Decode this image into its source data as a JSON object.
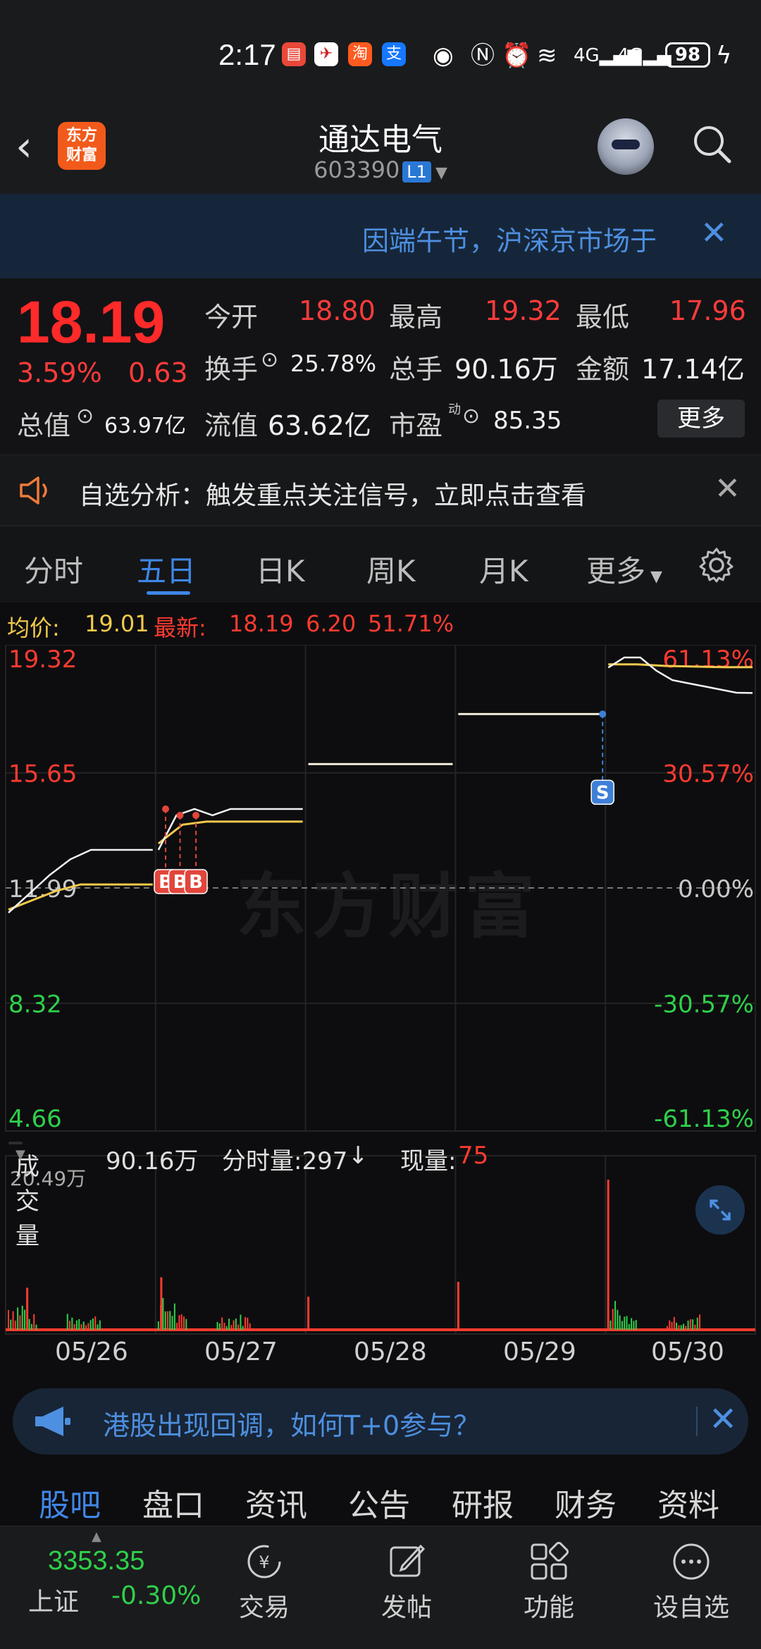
{
  "status": {
    "time": "2:17",
    "apps": [
      "huawei-app-icon",
      "airport-app-icon",
      "taobao-app-icon",
      "alipay-app-icon"
    ],
    "battery": "98"
  },
  "header": {
    "logo": "东方\n财富",
    "stock_name": "通达电气",
    "stock_code": "603390",
    "level": "L1"
  },
  "notice": {
    "text": "因端午节，沪深京市场于"
  },
  "quote": {
    "price": "18.19",
    "change_pct": "3.59%",
    "change": "0.63",
    "open_label": "今开",
    "open": "18.80",
    "high_label": "最高",
    "high": "19.32",
    "low_label": "最低",
    "low": "17.96",
    "turnover_label": "换手",
    "turnover": "25.78%",
    "volume_label": "总手",
    "volume": "90.16万",
    "amount_label": "金额",
    "amount": "17.14亿",
    "total_mv_label": "总值",
    "total_mv": "63.97亿",
    "float_mv_label": "流值",
    "float_mv": "63.62亿",
    "pe_label": "市盈",
    "pe_sup": "动",
    "pe": "85.35",
    "more": "更多"
  },
  "analysis": {
    "text": "自选分析：触发重点关注信号，立即点击查看"
  },
  "tabs": [
    "分时",
    "五日",
    "日K",
    "周K",
    "月K",
    "更多"
  ],
  "active_tab": "五日",
  "infoline": {
    "avg_label": "均价:",
    "avg": "19.01",
    "last_label": "最新:",
    "last": "18.19",
    "chg": "6.20",
    "pct": "51.71%"
  },
  "chart_data": {
    "type": "line",
    "y_left": [
      "19.32",
      "15.65",
      "11.99",
      "8.32",
      "4.66"
    ],
    "y_right": [
      "61.13%",
      "30.57%",
      "0.00%",
      "-30.57%",
      "-61.13%"
    ],
    "x_dates": [
      "05/26",
      "05/27",
      "05/28",
      "05/29",
      "05/30"
    ],
    "ylim": [
      4.66,
      19.32
    ],
    "prev_close": 11.99,
    "days": [
      {
        "date": "05/26",
        "price": [
          11.2,
          11.8,
          12.4,
          12.9,
          13.2,
          13.2,
          13.2,
          13.2
        ],
        "avg": [
          11.3,
          11.6,
          11.9,
          12.1,
          12.1,
          12.1,
          12.1
        ]
      },
      {
        "date": "05/27",
        "price": [
          13.2,
          14.3,
          14.5,
          14.3,
          14.5,
          14.5,
          14.5,
          14.5,
          14.5
        ],
        "avg": [
          13.4,
          14.0,
          14.1,
          14.1,
          14.1,
          14.1,
          14.1
        ]
      },
      {
        "date": "05/28",
        "price": [
          15.93,
          15.93
        ],
        "avg": [
          15.93,
          15.93
        ]
      },
      {
        "date": "05/29",
        "price": [
          17.52,
          17.52
        ],
        "avg": [
          17.52,
          17.52
        ]
      },
      {
        "date": "05/30",
        "price": [
          19.0,
          19.32,
          19.32,
          18.9,
          18.6,
          18.5,
          18.4,
          18.3,
          18.2,
          18.19
        ],
        "avg": [
          19.1,
          19.1,
          19.05,
          19.03,
          19.01,
          19.01
        ]
      }
    ],
    "markers": [
      {
        "label": "B",
        "day": 1,
        "pos": 0.05,
        "price": 14.5
      },
      {
        "label": "B",
        "day": 1,
        "pos": 0.15,
        "price": 14.3
      },
      {
        "label": "B",
        "day": 1,
        "pos": 0.26,
        "price": 14.3
      },
      {
        "label": "S",
        "day": 3,
        "pos": 1.0,
        "price": 17.52
      }
    ],
    "volume_max": "20.49万",
    "volume_spikes": [
      {
        "day": 0,
        "pos": 0.13,
        "v": 0.28
      },
      {
        "day": 1,
        "pos": 0.02,
        "v": 0.35
      },
      {
        "day": 2,
        "pos": 0.0,
        "v": 0.22
      },
      {
        "day": 3,
        "pos": 0.0,
        "v": 0.32
      },
      {
        "day": 4,
        "pos": 0.0,
        "v": 1.0
      }
    ],
    "colors": {
      "price": "#f2f2f2",
      "avg": "#f2c94c",
      "up": "#ff3b30",
      "down": "#2fd04a",
      "grid": "#242424"
    }
  },
  "volume": {
    "tag": "成交量",
    "total": "90.16万",
    "tick_label": "分时量:297",
    "tick_arrow": "↓",
    "now_label": "现量:",
    "now": "75"
  },
  "promo": {
    "text": "港股出现回调，如何T+0参与？"
  },
  "bottom_tabs": [
    "股吧",
    "盘口",
    "资讯",
    "公告",
    "研报",
    "财务",
    "资料"
  ],
  "bottom_active": "股吧",
  "index": {
    "value": "3353.35",
    "name": "上证",
    "change": "-0.30%"
  },
  "nav": [
    "交易",
    "发帖",
    "功能",
    "设自选"
  ]
}
